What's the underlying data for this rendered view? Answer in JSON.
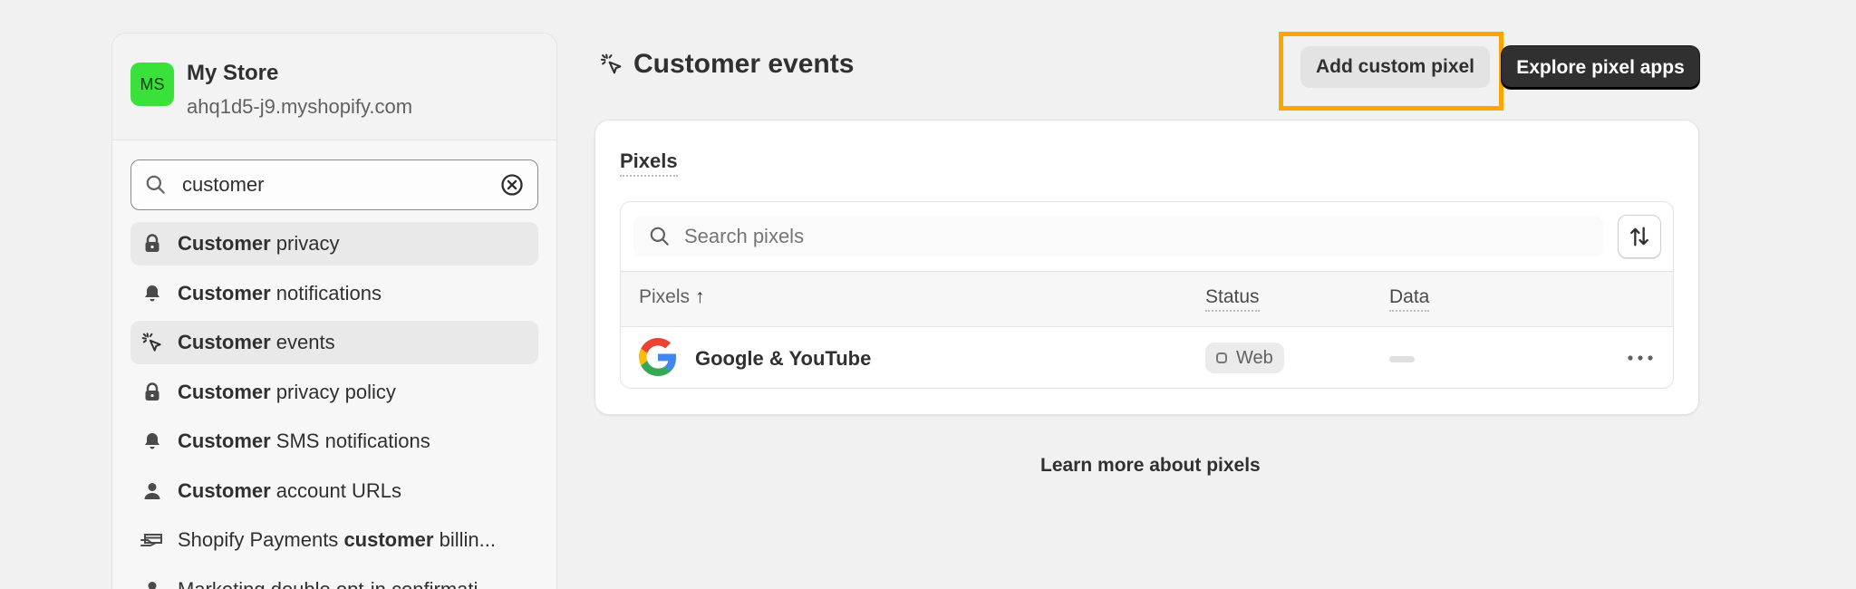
{
  "store": {
    "avatar_initials": "MS",
    "name": "My Store",
    "domain": "ahq1d5-j9.myshopify.com"
  },
  "sidebar_search": {
    "value": "customer",
    "clear_icon": "circle-x-icon",
    "search_icon": "search-icon"
  },
  "search_results": [
    {
      "icon": "lock-icon",
      "bold": "Customer",
      "rest": " privacy",
      "active": true
    },
    {
      "icon": "bell-icon",
      "bold": "Customer",
      "rest": " notifications",
      "active": false
    },
    {
      "icon": "cursor-click-icon",
      "bold": "Customer",
      "rest": " events",
      "active": true
    },
    {
      "icon": "lock-icon",
      "bold": "Customer",
      "rest": " privacy policy",
      "active": false
    },
    {
      "icon": "bell-icon",
      "bold": "Customer",
      "rest": " SMS notifications",
      "active": false
    },
    {
      "icon": "person-icon",
      "bold": "Customer",
      "rest": " account URLs",
      "active": false
    },
    {
      "icon": "hand-card-icon",
      "pre": "Shopify Payments ",
      "bold": "customer",
      "rest": " billin...",
      "active": false
    },
    {
      "icon": "person-icon",
      "pre": "Marketing double opt-in confirmati",
      "bold": "",
      "rest": "",
      "active": false
    }
  ],
  "page": {
    "title": "Customer events",
    "title_icon": "cursor-click-icon"
  },
  "actions": {
    "add_custom_pixel": "Add custom pixel",
    "explore_pixel_apps": "Explore pixel apps",
    "highlight_color": "#ffa500"
  },
  "pixels_card": {
    "title": "Pixels",
    "search_placeholder": "Search pixels",
    "sort_icon": "sort-arrows-icon",
    "columns": {
      "pixels": "Pixels",
      "pixels_sort": "↑",
      "status": "Status",
      "data": "Data"
    },
    "rows": [
      {
        "logo": "google-g-icon",
        "name": "Google & YouTube",
        "status": "Web",
        "data": "",
        "menu_icon": "more-horizontal-icon"
      }
    ]
  },
  "learn_more": "Learn more about pixels"
}
